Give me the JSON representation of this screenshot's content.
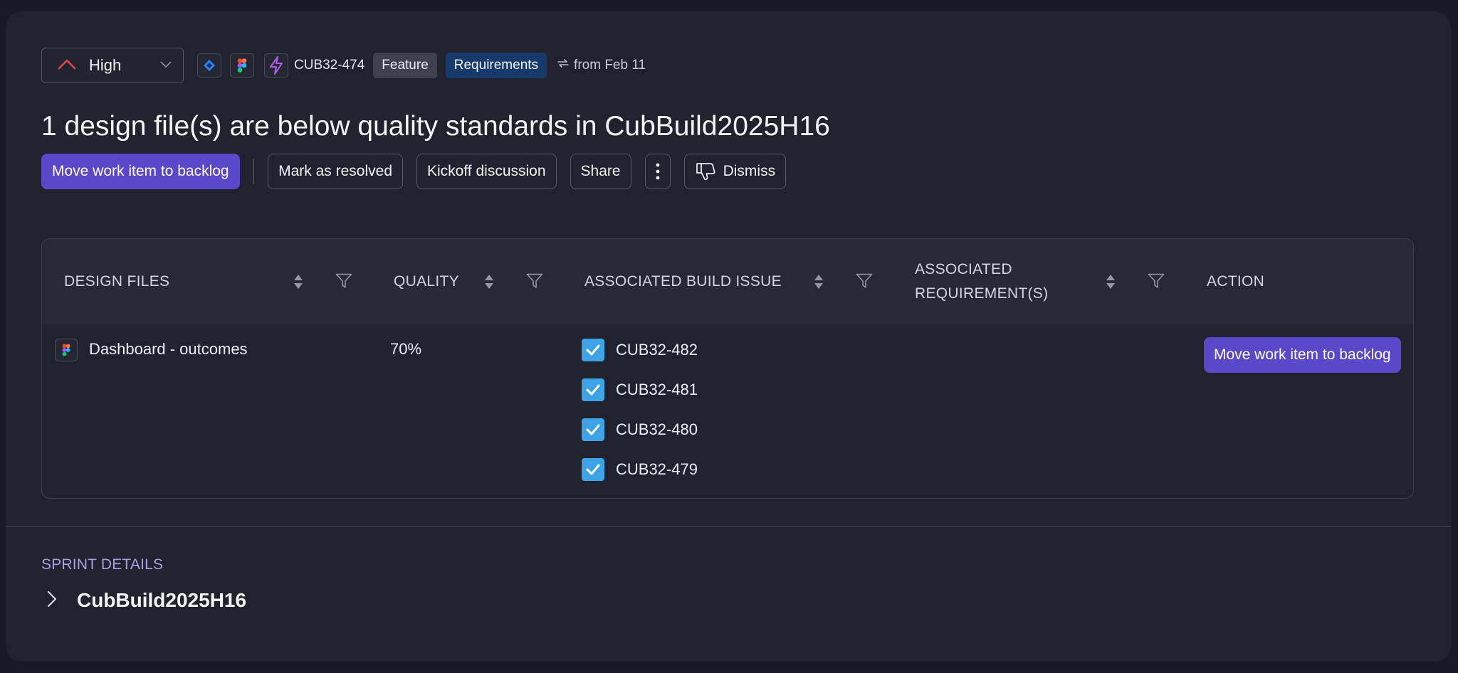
{
  "header": {
    "priority": "High",
    "issue_key": "CUB32-474",
    "tags": [
      "Feature",
      "Requirements"
    ],
    "from_label": "from Feb 11",
    "icons": [
      "priority-high-arrow",
      "jira-icon",
      "figma-icon",
      "bolt-icon",
      "sync-icon"
    ]
  },
  "title": "1 design file(s) are below quality standards in CubBuild2025H16",
  "actions": {
    "primary": "Move work item to backlog",
    "resolve": "Mark as resolved",
    "kickoff": "Kickoff discussion",
    "share": "Share",
    "dismiss": "Dismiss"
  },
  "table": {
    "columns": [
      "DESIGN FILES",
      "QUALITY",
      "ASSOCIATED BUILD ISSUE",
      "ASSOCIATED",
      "REQUIREMENT(S)",
      "ACTION"
    ],
    "rows": [
      {
        "design_file": "Dashboard - outcomes",
        "quality": "70%",
        "issues": [
          "CUB32-482",
          "CUB32-481",
          "CUB32-480",
          "CUB32-479"
        ],
        "action": "Move work item to backlog"
      }
    ]
  },
  "sprint": {
    "heading": "SPRINT DETAILS",
    "name": "CubBuild2025H16"
  },
  "colors": {
    "accent": "#5a47c9",
    "checkbox": "#3ea3e6",
    "priority_high": "#e0474c",
    "requirements_tag": "#173a6d",
    "sprint_heading": "#a99fe8"
  }
}
